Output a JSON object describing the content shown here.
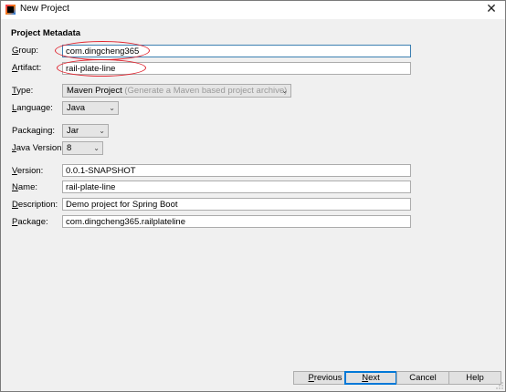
{
  "window": {
    "title": "New Project",
    "close_glyph": "✕"
  },
  "section": {
    "title": "Project Metadata"
  },
  "fields": {
    "group": {
      "label_accel": "G",
      "label_rest": "roup:",
      "value": "com.dingcheng365"
    },
    "artifact": {
      "label_accel": "A",
      "label_rest": "rtifact:",
      "value": "rail-plate-line"
    },
    "type": {
      "label_accel": "T",
      "label_rest": "ype:",
      "value": "Maven Project",
      "hint": "(Generate a Maven based project archive)"
    },
    "language": {
      "label_accel": "L",
      "label_rest": "anguage:",
      "value": "Java"
    },
    "packaging": {
      "label_pre": "Packa",
      "label_accel": "g",
      "label_rest": "ing:",
      "value": "Jar"
    },
    "java_version": {
      "label_accel": "J",
      "label_rest": "ava Version:",
      "value": "8"
    },
    "version": {
      "label_accel": "V",
      "label_rest": "ersion:",
      "value": "0.0.1-SNAPSHOT"
    },
    "name": {
      "label_accel": "N",
      "label_rest": "ame:",
      "value": "rail-plate-line"
    },
    "description": {
      "label_accel": "D",
      "label_rest": "escription:",
      "value": "Demo project for Spring Boot"
    },
    "package": {
      "label_accel": "P",
      "label_rest": "ackage:",
      "value": "com.dingcheng365.railplateline"
    }
  },
  "buttons": {
    "previous": {
      "accel": "P",
      "rest": "revious"
    },
    "next": {
      "accel": "N",
      "rest": "ext"
    },
    "cancel": {
      "label": "Cancel"
    },
    "help": {
      "label": "Help"
    }
  },
  "icons": {
    "dropdown_arrow": "⌄",
    "annotation_color": "#e0242f",
    "focus_color": "#3c7fb1"
  }
}
